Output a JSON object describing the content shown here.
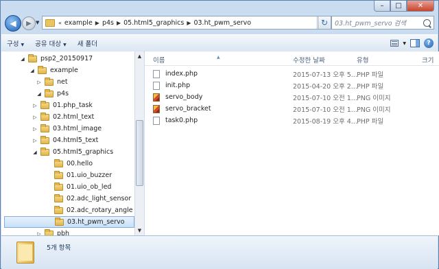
{
  "window": {
    "caption_buttons": [
      "–",
      "□",
      "✕"
    ]
  },
  "address": {
    "overflow": "«",
    "crumbs": [
      "example",
      "p4s",
      "05.html5_graphics",
      "03.ht_pwm_servo"
    ],
    "search_placeholder": "03.ht_pwm_servo 검색"
  },
  "toolbar": {
    "organize": "구성",
    "share": "공유 대상",
    "new_folder": "새 폴더"
  },
  "tree": [
    {
      "label": "psp2_20150917",
      "expanded": true,
      "depth": 1
    },
    {
      "label": "example",
      "expanded": true,
      "depth": 2
    },
    {
      "label": "net",
      "expanded": false,
      "depth": 3
    },
    {
      "label": "p4s",
      "expanded": true,
      "depth": 3
    },
    {
      "label": "01.php_task",
      "expanded": false,
      "depth": 4
    },
    {
      "label": "02.html_text",
      "expanded": false,
      "depth": 4
    },
    {
      "label": "03.html_image",
      "expanded": false,
      "depth": 4
    },
    {
      "label": "04.html5_text",
      "expanded": false,
      "depth": 4
    },
    {
      "label": "05.html5_graphics",
      "expanded": true,
      "depth": 4
    },
    {
      "label": "00.hello",
      "depth": 5
    },
    {
      "label": "01.uio_buzzer",
      "depth": 5
    },
    {
      "label": "01.uio_ob_led",
      "depth": 5
    },
    {
      "label": "02.adc_light_sensor",
      "depth": 5
    },
    {
      "label": "02.adc_rotary_angle",
      "depth": 5
    },
    {
      "label": "03.ht_pwm_servo",
      "depth": 5,
      "selected": true
    },
    {
      "label": "pbh",
      "expanded": false,
      "depth": 3
    }
  ],
  "columns": {
    "name": "이름",
    "date": "수정한 날짜",
    "type": "유형",
    "size": "크기"
  },
  "files": [
    {
      "name": "index.php",
      "date": "2015-07-13 오후 5...",
      "type": "PHP 파일",
      "icon": "php-file-icon"
    },
    {
      "name": "init.php",
      "date": "2015-04-20 오후 2...",
      "type": "PHP 파일",
      "icon": "php-file-icon"
    },
    {
      "name": "servo_body",
      "date": "2015-07-10 오전 1...",
      "type": "PNG 이미지",
      "icon": "png-image-icon"
    },
    {
      "name": "servo_bracket",
      "date": "2015-07-10 오전 1...",
      "type": "PNG 이미지",
      "icon": "png-image-icon"
    },
    {
      "name": "task0.php",
      "date": "2015-08-19 오후 4...",
      "type": "PHP 파일",
      "icon": "php-file-icon"
    }
  ],
  "status": {
    "item_count": "5개 항목"
  }
}
